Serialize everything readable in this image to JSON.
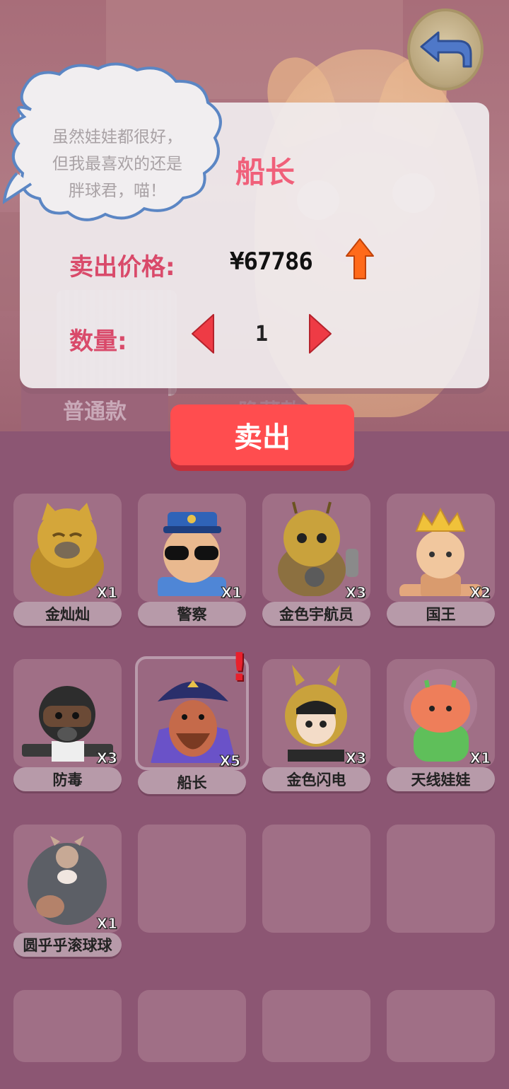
{
  "bubble": {
    "lines": [
      "虽然娃娃都很好，",
      "但我最喜欢的还是",
      "胖球君，喵！"
    ]
  },
  "modal": {
    "item_name": "船长",
    "price_label": "卖出价格:",
    "price_value": "¥67786",
    "price_trend_icon": "arrow-up-icon",
    "qty_label": "数量:",
    "qty_value": "1"
  },
  "tabs": [
    {
      "label": "普通款"
    },
    {
      "label": "隐藏款"
    }
  ],
  "sell_button": {
    "label": "卖出"
  },
  "alert_mark": "!",
  "items": [
    {
      "name": "金灿灿",
      "count": "X1"
    },
    {
      "name": "警察",
      "count": "X1"
    },
    {
      "name": "金色宇航员",
      "count": "X3"
    },
    {
      "name": "国王",
      "count": "X2"
    },
    {
      "name": "防毒",
      "count": "X3"
    },
    {
      "name": "船长",
      "count": "X5"
    },
    {
      "name": "金色闪电",
      "count": "X3"
    },
    {
      "name": "天线娃娃",
      "count": "X1"
    },
    {
      "name": "圆乎乎滚球球",
      "count": "X1"
    }
  ],
  "colors": {
    "accent": "#ff4d4f",
    "title": "#f0607a",
    "label": "#d94a6a",
    "background": "#8c5673"
  }
}
